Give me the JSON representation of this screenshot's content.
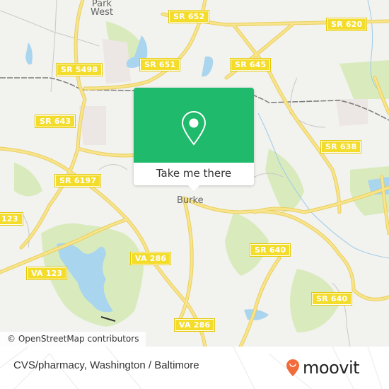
{
  "map": {
    "place_labels": [
      {
        "name": "Park West",
        "line1": "Park",
        "line2": "West"
      },
      {
        "name": "Burke",
        "text": "Burke"
      }
    ],
    "road_shields": [
      "SR 652",
      "SR 620",
      "SR 5498",
      "SR 651",
      "SR 645",
      "SR 643",
      "SR 638",
      "SR 6197",
      "123",
      "VA 123",
      "VA 286",
      "SR 640",
      "SR 640",
      "VA 286"
    ],
    "colors": {
      "background": "#f2f2ef",
      "road": "#f6dc6a",
      "park": "#d5e8b5",
      "water": "#a8d4ee",
      "railway": "#777777",
      "shield": "#f4dc2a"
    }
  },
  "popup": {
    "icon": "location-pin-icon",
    "button_label": "Take me there",
    "color": "#1fba6b"
  },
  "attribution": "© OpenStreetMap contributors",
  "footer": {
    "title": "CVS/pharmacy, Washington / Baltimore",
    "logo_text": "moovit",
    "logo_color": "#f26b3a"
  }
}
